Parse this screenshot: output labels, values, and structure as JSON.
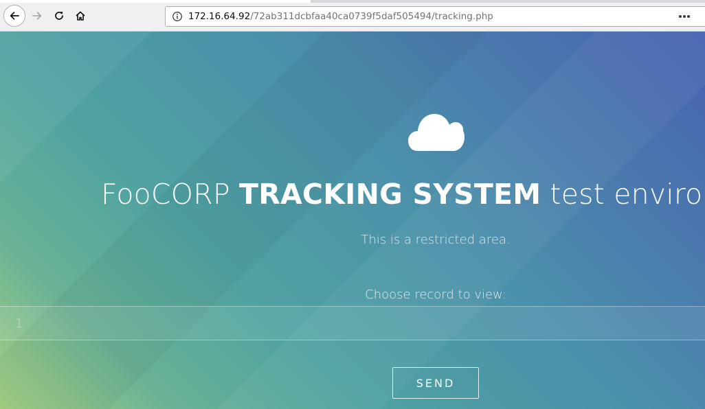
{
  "browser": {
    "url_host": "172.16.64.92",
    "url_path": "/72ab311dcbfaa40ca0739f5daf505494/tracking.php",
    "icons": [
      "back-arrow-icon",
      "forward-arrow-icon",
      "reload-icon",
      "home-icon",
      "info-icon",
      "more-dots-icon"
    ]
  },
  "page": {
    "icon": "cloud-icon",
    "title_prefix": "FooCORP ",
    "title_strong": "TRACKING SYSTEM",
    "title_suffix": " test environment",
    "subtitle": "This is a restricted area.",
    "record_label": "Choose record to view:",
    "record_placeholder": "1",
    "send_label": "SEND"
  },
  "colors": {
    "gradient_start": "#a6d283",
    "gradient_mid": "#4fa2a1",
    "gradient_end": "#4663b2",
    "text": "#ffffff"
  }
}
